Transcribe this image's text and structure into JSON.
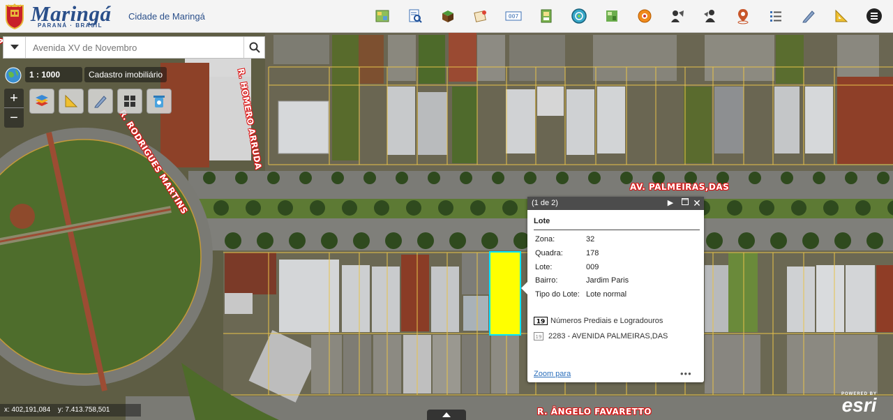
{
  "header": {
    "logo_name": "Maringá",
    "logo_sub": "PARANÁ · BRASIL",
    "app_title": "Cidade de Maringá",
    "tools": [
      "map-layers-icon",
      "document-search-icon",
      "3d-block-icon",
      "map-note-icon",
      "numbering-icon",
      "print-icon",
      "globe-icon",
      "parcel-icon",
      "location-icon",
      "measure-person-icon",
      "street-view-icon",
      "pin-icon",
      "list-icon",
      "pencil-icon",
      "ruler-icon",
      "menu-icon"
    ]
  },
  "search": {
    "value": "Avenida XV de Novembro"
  },
  "map": {
    "scale_label": "1 : 1000",
    "layer_label": "Cadastro imobiliário",
    "zoom_in": "+",
    "zoom_out": "−",
    "streets": {
      "s1": "R. HOMERO ARRUDA",
      "s2": "R. RODRIGUES MARTINS",
      "s3": "AV. PALMEIRAS,DAS",
      "s4": "R. ÂNGELO FAVARETTO",
      "s5": "A"
    },
    "coords": {
      "x": "x: 402,191,084",
      "y": "y: 7.413.758,501"
    },
    "attribution_top": "POWERED BY",
    "attribution_logo": "esri"
  },
  "popup": {
    "counter": "(1 de 2)",
    "title": "Lote",
    "fields": [
      {
        "key": "Zona:",
        "value": "32"
      },
      {
        "key": "Quadra:",
        "value": "178"
      },
      {
        "key": "Lote:",
        "value": "009"
      },
      {
        "key": "Bairro:",
        "value": "Jardim Paris"
      },
      {
        "key": "Tipo do Lote:",
        "value": "Lote normal"
      }
    ],
    "related_label": "Números Prediais e Logradouros",
    "related_item": "2283 - AVENIDA PALMEIRAS,DAS",
    "zoom_link": "Zoom para",
    "more": "•••"
  },
  "colors": {
    "header_bg": "#f4f4f4",
    "brand": "#2a4f8a",
    "highlight_fill": "#ffff00",
    "highlight_stroke": "#00e5ff",
    "parcel_lines": "#e8c34a",
    "street_label": "#ffffff",
    "street_outline": "#dd1111"
  }
}
